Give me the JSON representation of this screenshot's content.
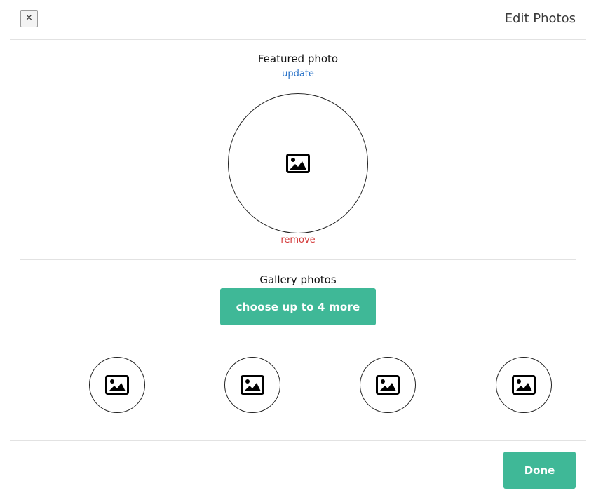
{
  "header": {
    "close_label": "×",
    "title": "Edit Photos"
  },
  "featured": {
    "title": "Featured photo",
    "update_label": "update",
    "remove_label": "remove",
    "placeholder_icon": "image-icon"
  },
  "gallery": {
    "title": "Gallery photos",
    "choose_label": "choose up to 4 more",
    "slots": [
      {
        "icon": "image-icon"
      },
      {
        "icon": "image-icon"
      },
      {
        "icon": "image-icon"
      },
      {
        "icon": "image-icon"
      }
    ]
  },
  "footer": {
    "done_label": "Done"
  },
  "colors": {
    "accent": "#3fb897",
    "link_blue": "#2a73c9",
    "remove_red": "#d43b3b"
  }
}
